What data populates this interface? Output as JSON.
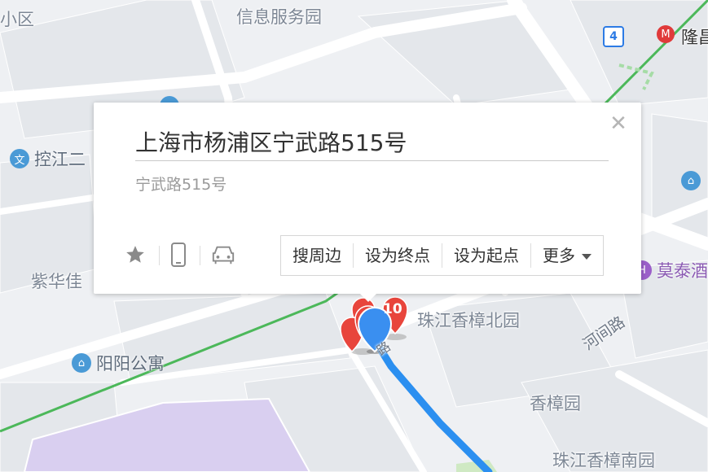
{
  "map": {
    "labels": {
      "community_topleft": "小区",
      "info_park": "信息服务园",
      "zhujiang_north": "珠江香樟北园",
      "xiangzhang": "香樟园",
      "zhujiang_south": "珠江香樟南园",
      "zihua_partial": "紫华佳"
    },
    "pois": {
      "kongjiang": "控江二",
      "yangyang": "阳阳公寓",
      "motai": "莫泰酒",
      "longchang": "隆昌"
    },
    "roads": {
      "hejian": "河间路",
      "ningwu_partial": "路"
    },
    "metro": {
      "line_number": "4",
      "logo_symbol": "M"
    },
    "markers": {
      "cluster_count": "10",
      "poi_glyph": "文",
      "hotel_glyph": "H",
      "park_glyph": "⌂"
    },
    "colors": {
      "route_blue": "#2b8ff0",
      "metro_green": "#4cb85a",
      "marker_red": "#e8453c",
      "location_blue": "#3a8ff0",
      "campus_purple": "#d9cff0"
    }
  },
  "popup": {
    "title": "上海市杨浦区宁武路515号",
    "subtitle": "宁武路515号",
    "close_icon": "close-icon",
    "icons": [
      "star-icon",
      "phone-icon",
      "car-icon"
    ],
    "actions": {
      "search_nearby": "搜周边",
      "set_destination": "设为终点",
      "set_origin": "设为起点",
      "more": "更多"
    }
  }
}
